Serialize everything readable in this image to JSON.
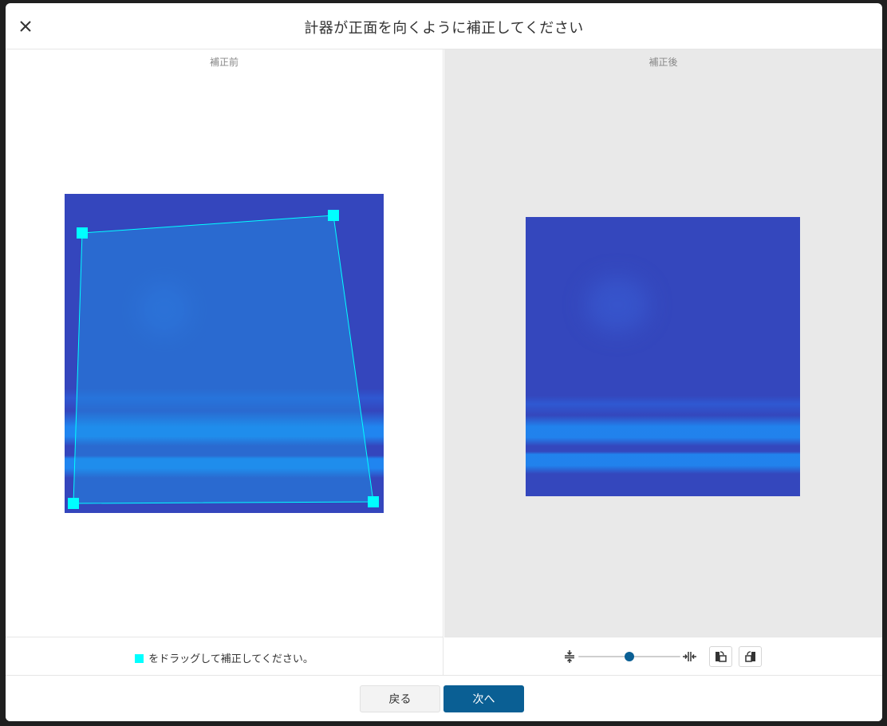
{
  "dialog": {
    "title": "計器が正面を向くように補正してください",
    "close_icon": "close-icon"
  },
  "panels": {
    "before_label": "補正前",
    "after_label": "補正後"
  },
  "hint": {
    "text": "をドラッグして補正してください。"
  },
  "zoom": {
    "min_icon": "zoom-out-icon",
    "max_icon": "zoom-in-icon",
    "value_fraction": 0.5
  },
  "tools": {
    "rotate_left_icon": "rotate-left-icon",
    "rotate_right_icon": "rotate-right-icon"
  },
  "buttons": {
    "back_label": "戻る",
    "next_label": "次へ"
  },
  "colors": {
    "handle": "#00ffff",
    "primary": "#0a5f94",
    "image_base": "#3446bd"
  }
}
